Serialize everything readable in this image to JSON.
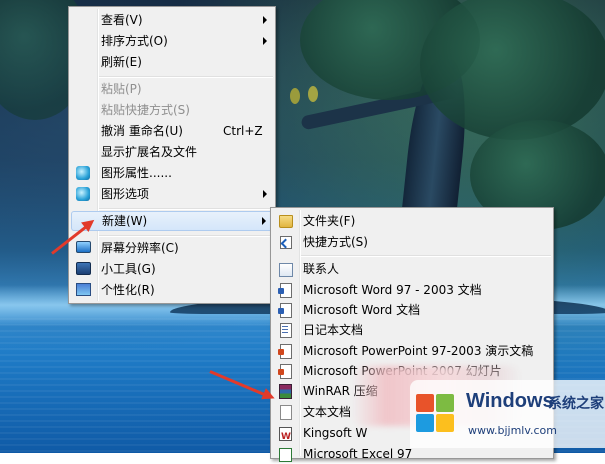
{
  "main_menu": {
    "items": [
      {
        "label": "查看(V)",
        "submenu": true
      },
      {
        "label": "排序方式(O)",
        "submenu": true
      },
      {
        "label": "刷新(E)"
      },
      {
        "label": "粘贴(P)",
        "disabled": true
      },
      {
        "label": "粘贴快捷方式(S)",
        "disabled": true
      },
      {
        "label": "撤消 重命名(U)",
        "shortcut": "Ctrl+Z"
      },
      {
        "label": "显示扩展名及文件"
      },
      {
        "label": "图形属性......",
        "icon": "graphics-icon"
      },
      {
        "label": "图形选项",
        "icon": "graphics-icon",
        "submenu": true
      },
      {
        "label": "新建(W)",
        "submenu": true,
        "highlighted": true
      },
      {
        "label": "屏幕分辨率(C)",
        "icon": "screen-resolution-icon"
      },
      {
        "label": "小工具(G)",
        "icon": "gadgets-icon"
      },
      {
        "label": "个性化(R)",
        "icon": "personalize-icon"
      }
    ]
  },
  "new_submenu": {
    "items": [
      {
        "label": "文件夹(F)",
        "icon": "folder-icon"
      },
      {
        "label": "快捷方式(S)",
        "icon": "shortcut-icon"
      },
      {
        "label": "联系人",
        "icon": "contact-icon"
      },
      {
        "label": "Microsoft Word 97 - 2003 文档",
        "icon": "word-doc-icon"
      },
      {
        "label": "Microsoft Word 文档",
        "icon": "word-doc-icon"
      },
      {
        "label": "日记本文档",
        "icon": "journal-icon"
      },
      {
        "label": "Microsoft PowerPoint 97-2003 演示文稿",
        "icon": "ppt-icon"
      },
      {
        "label": "Microsoft PowerPoint 2007 幻灯片",
        "icon": "ppt-icon"
      },
      {
        "label": "WinRAR 压缩",
        "icon": "winrar-icon"
      },
      {
        "label": "文本文档",
        "icon": "text-doc-icon"
      },
      {
        "label": "Kingsoft W",
        "icon": "kingsoft-icon"
      },
      {
        "label": "Microsoft Excel 97",
        "icon": "excel-icon"
      }
    ]
  },
  "watermark": {
    "brand": "Windows",
    "brand_cn": "系统之家",
    "url": "www.bjjmlv.com"
  },
  "colors": {
    "menu_bg": "#f0f0f0",
    "highlight": "#d4e6fa",
    "annotation_red": "#e23a2a"
  }
}
